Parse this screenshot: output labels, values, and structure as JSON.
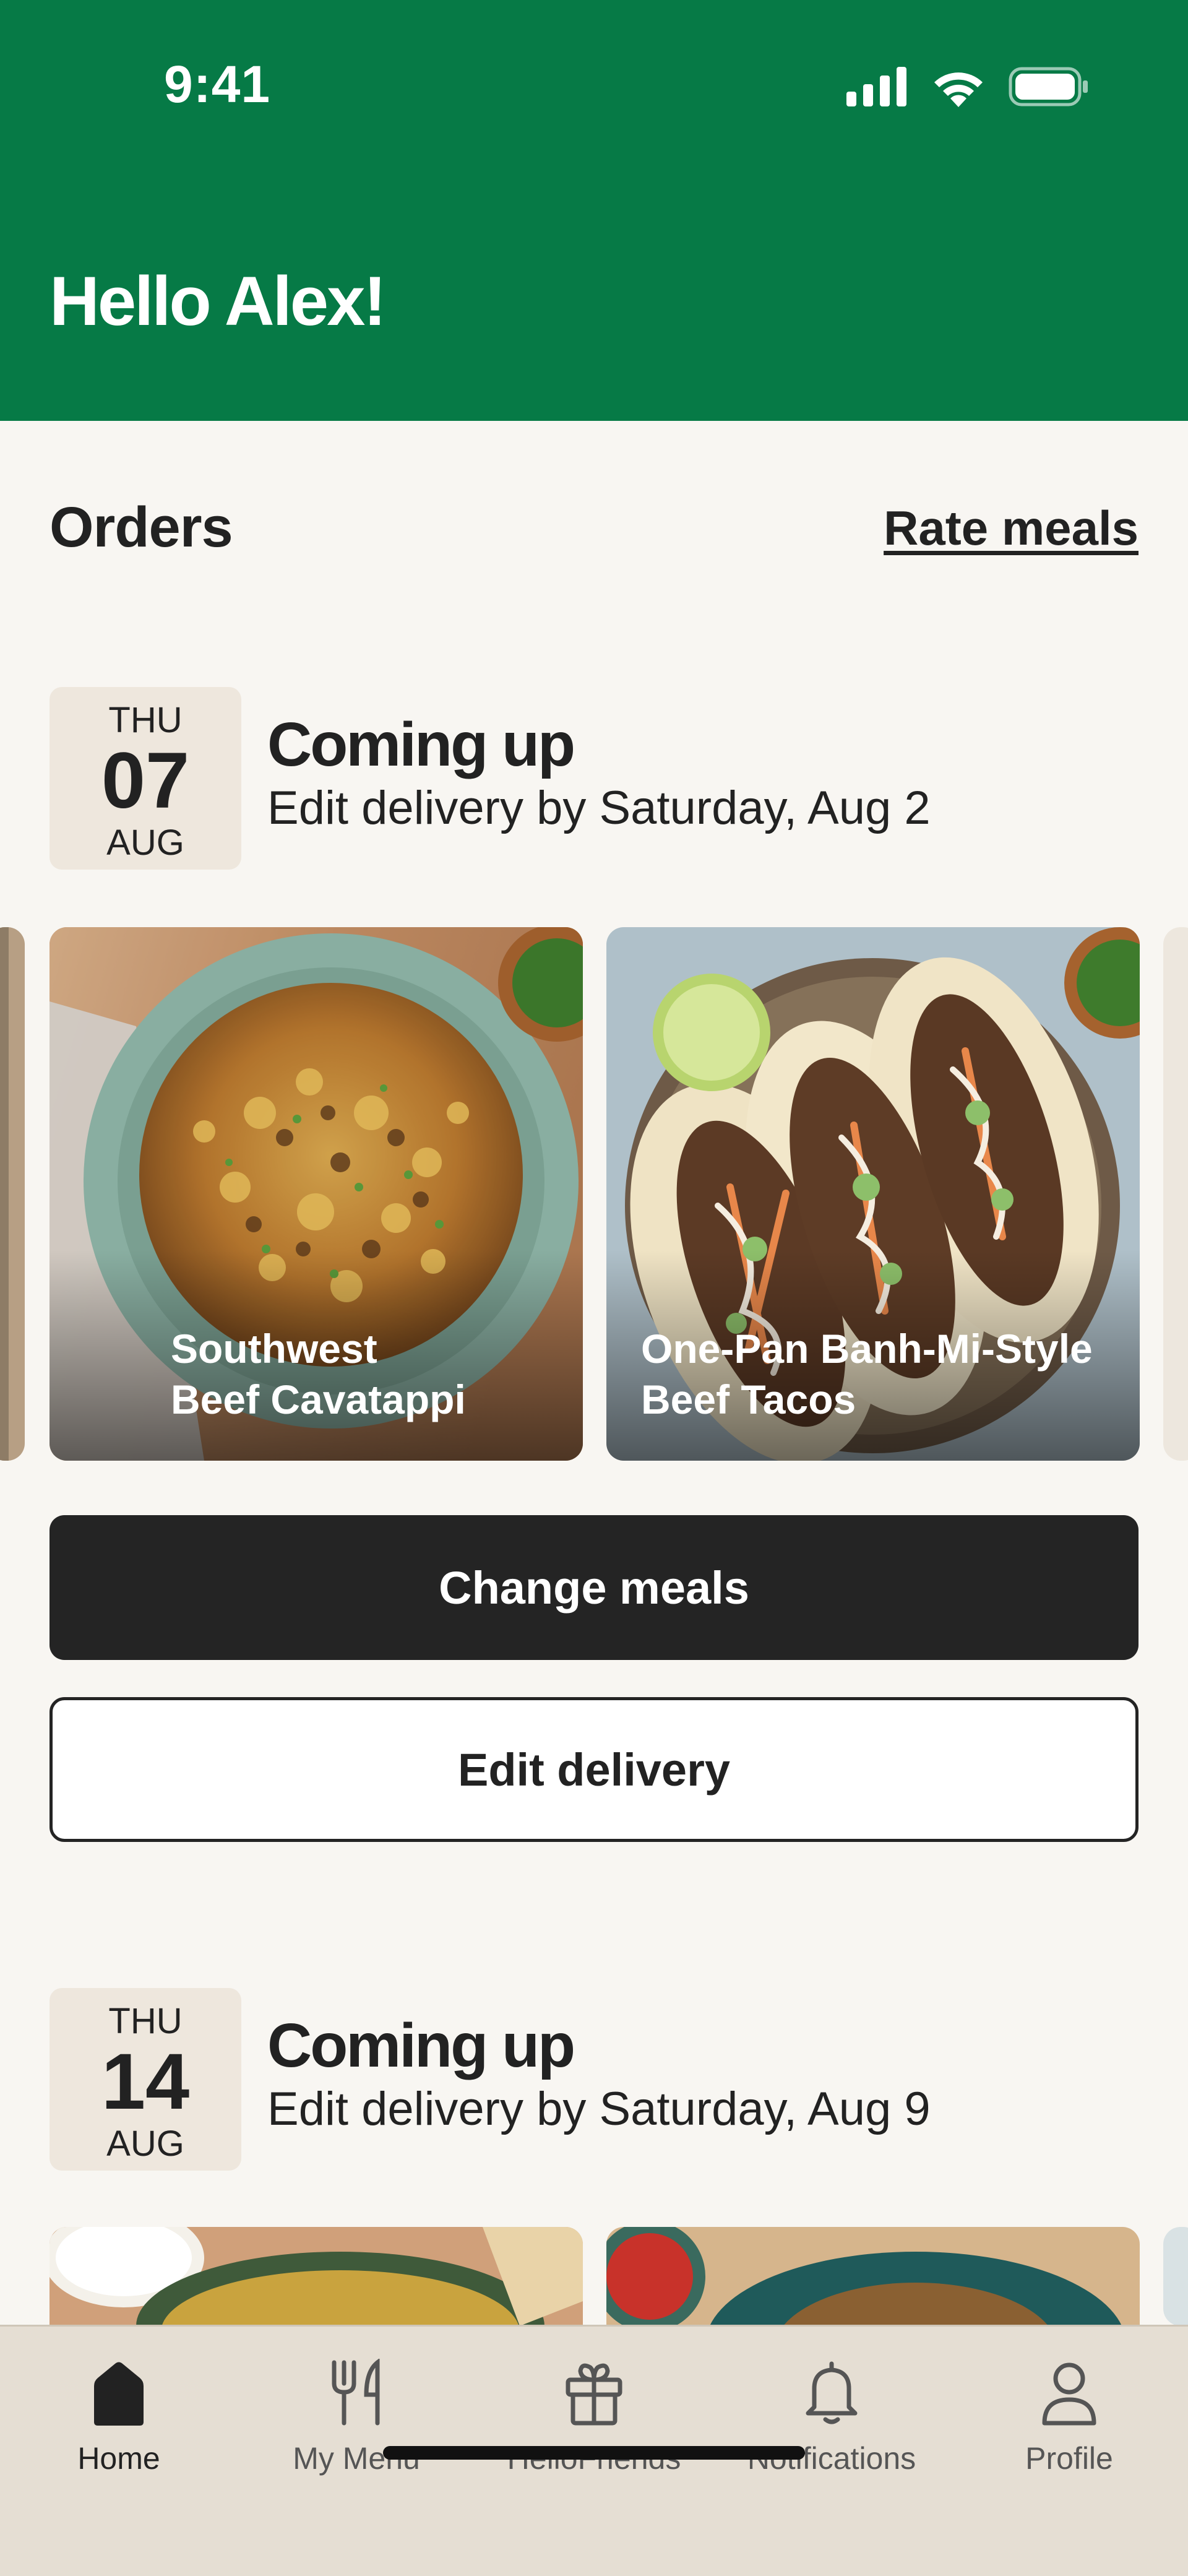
{
  "status_bar": {
    "time": "9:41"
  },
  "header": {
    "greeting": "Hello Alex!"
  },
  "orders_section": {
    "title": "Orders",
    "rate_meals_label": "Rate meals"
  },
  "orders": [
    {
      "date": {
        "weekday": "THU",
        "day": "07",
        "month": "AUG"
      },
      "title": "Coming up",
      "subtitle": "Edit delivery by Saturday, Aug 2",
      "meals": [
        {
          "line1": "Southwest",
          "line2": "Beef Cavatappi"
        },
        {
          "line1": "One-Pan Banh-Mi-Style",
          "line2": "Beef Tacos"
        }
      ],
      "primary_button": "Change meals",
      "secondary_button": "Edit delivery"
    },
    {
      "date": {
        "weekday": "THU",
        "day": "14",
        "month": "AUG"
      },
      "title": "Coming up",
      "subtitle": "Edit delivery by Saturday, Aug 9"
    }
  ],
  "bottom_nav": {
    "items": [
      {
        "label": "Home",
        "icon": "home-icon",
        "active": true
      },
      {
        "label": "My Menu",
        "icon": "fork-knife-icon",
        "active": false
      },
      {
        "label": "HelloFriends",
        "icon": "gift-icon",
        "active": false
      },
      {
        "label": "Notifications",
        "icon": "bell-icon",
        "active": false
      },
      {
        "label": "Profile",
        "icon": "person-icon",
        "active": false
      }
    ]
  },
  "colors": {
    "brand_green": "#067A46",
    "background": "#F8F6F2",
    "dark_button": "#242424",
    "nav_bg": "#E5DED3"
  }
}
